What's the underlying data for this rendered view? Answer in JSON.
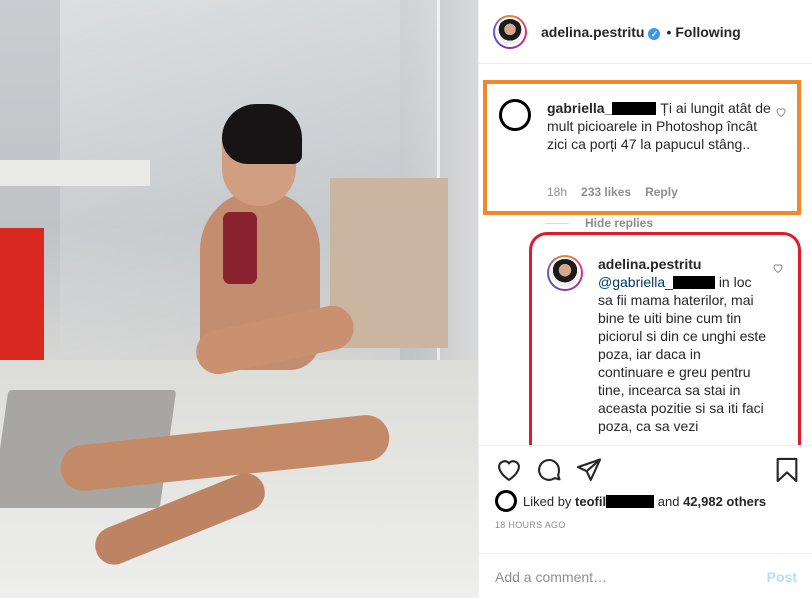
{
  "header": {
    "username": "adelina.pestritu",
    "verified_mark": "✓",
    "separator": "•",
    "follow_status": "Following"
  },
  "comment": {
    "username": "gabriella_",
    "text": "Ți ai lungit atât de mult picioarele in Photoshop încât zici ca porți 47 la papucul stâng..",
    "time": "18h",
    "likes": "233 likes",
    "reply_label": "Reply",
    "like_icon": "heart-outline-icon"
  },
  "hide_replies": "Hide replies",
  "reply": {
    "username": "adelina.pestritu",
    "mention": "@gabriella_",
    "text": "in loc sa fii mama haterilor, mai bine te uiti bine cum tin piciorul si din ce unghi este poza, iar daca in continuare e greu pentru tine, incearca sa stai in aceasta pozitie si sa iti faci poza, ca sa vezi",
    "like_icon": "heart-outline-icon"
  },
  "actions": {
    "icons": [
      "heart-icon",
      "comment-icon",
      "share-icon",
      "bookmark-icon"
    ]
  },
  "likes_line": {
    "prefix": "Liked by",
    "user": "teofil",
    "conjunction": "and",
    "others": "42,982 others"
  },
  "timestamp": "18 HOURS AGO",
  "add_comment": {
    "placeholder": "Add a comment…",
    "post_label": "Post"
  },
  "colors": {
    "orange_highlight": "#f0892a",
    "red_highlight": "#e11c28",
    "verified": "#3897f0",
    "post_disabled": "#b2dffc"
  }
}
